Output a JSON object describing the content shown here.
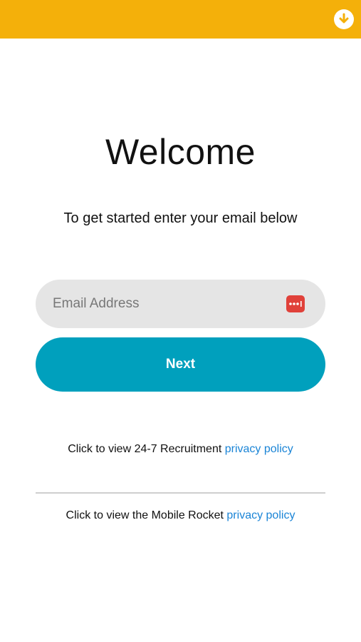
{
  "header": {
    "background_color": "#f4b00a",
    "download_icon": "arrow-down-circle-icon"
  },
  "main": {
    "title": "Welcome",
    "subtitle": "To get started enter your email below",
    "email": {
      "placeholder": "Email Address",
      "value": "",
      "autofill_icon": "password-key-icon",
      "autofill_color": "#e0413a"
    },
    "next_label": "Next",
    "next_color": "#00a0bd"
  },
  "footer": {
    "policy_1": {
      "prefix": "Click to view 24-7 Recruitment ",
      "link": "privacy policy"
    },
    "policy_2": {
      "prefix": "Click to view the Mobile Rocket ",
      "link": "privacy policy"
    },
    "link_color": "#1a84d6"
  }
}
